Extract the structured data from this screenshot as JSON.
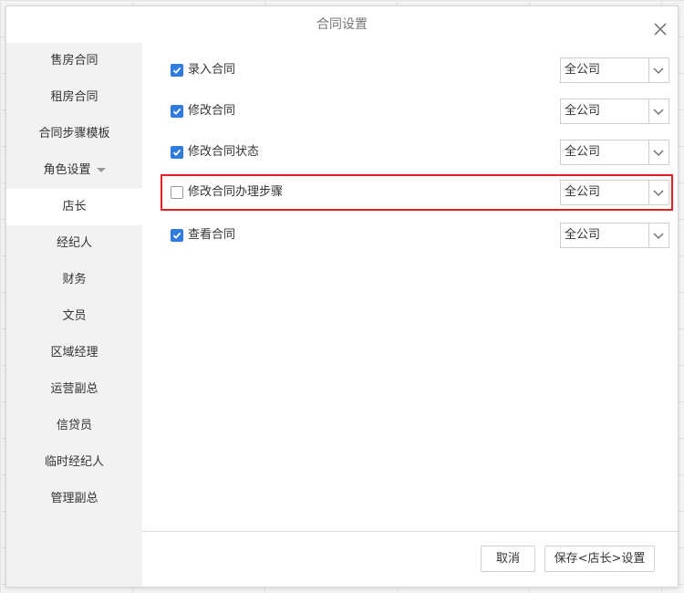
{
  "dialog": {
    "title": "合同设置"
  },
  "sidebar": {
    "items": [
      {
        "label": "售房合同"
      },
      {
        "label": "租房合同"
      },
      {
        "label": "合同步骤模板"
      },
      {
        "label": "角色设置"
      },
      {
        "label": "店长"
      },
      {
        "label": "经纪人"
      },
      {
        "label": "财务"
      },
      {
        "label": "文员"
      },
      {
        "label": "区域经理"
      },
      {
        "label": "运营副总"
      },
      {
        "label": "信贷员"
      },
      {
        "label": "临时经纪人"
      },
      {
        "label": "管理副总"
      }
    ],
    "active_index": 4
  },
  "permissions": [
    {
      "label": "录入合同",
      "checked": true,
      "scope": "全公司"
    },
    {
      "label": "修改合同",
      "checked": true,
      "scope": "全公司"
    },
    {
      "label": "修改合同状态",
      "checked": true,
      "scope": "全公司"
    },
    {
      "label": "修改合同办理步骤",
      "checked": false,
      "scope": "全公司",
      "highlighted": true
    },
    {
      "label": "查看合同",
      "checked": true,
      "scope": "全公司"
    }
  ],
  "footer": {
    "cancel_label": "取消",
    "save_label": "保存<店长>设置"
  },
  "colors": {
    "checkbox_checked": "#2f7ce0",
    "highlight_border": "#e02020"
  }
}
